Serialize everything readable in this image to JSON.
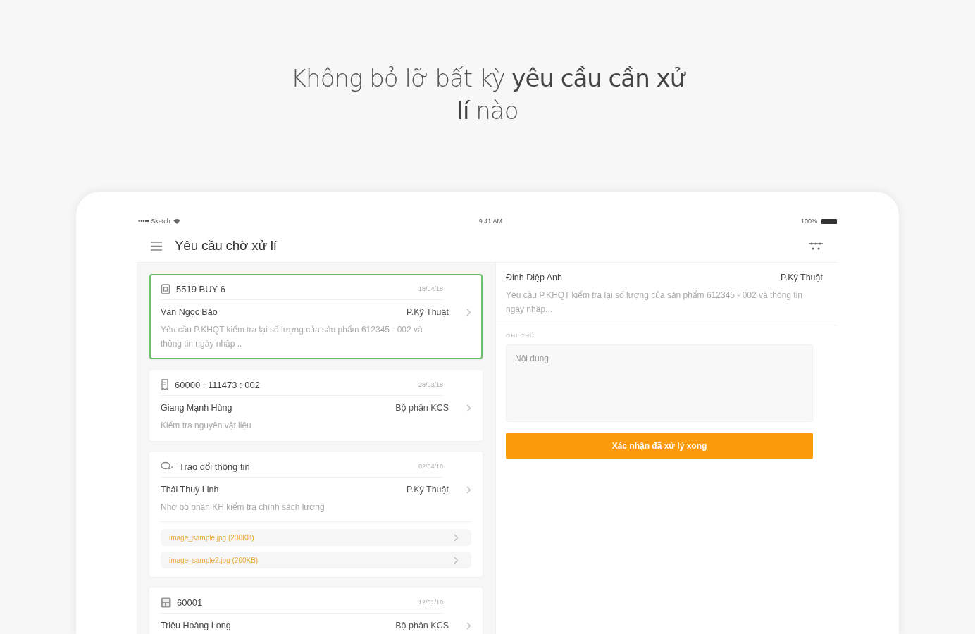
{
  "headline": "Không bỏ lỡ bất kỳ **yêu cầu cần xử lí** nào",
  "status_bar": {
    "carrier": "••••• Sketch",
    "time": "9:41 AM",
    "battery": "100%"
  },
  "header": {
    "title": "Yêu cầu chờ xử lí"
  },
  "requests": [
    {
      "kind": "document",
      "code": "5519 BUY 6",
      "date": "18/04/18",
      "name": "Văn Ngọc Bảo",
      "department": "P.Kỹ Thuật",
      "description": "Yêu cầu P.KHQT kiểm tra lại số lượng của sản phẩm 612345 - 002 và thông tin ngày nhập ..",
      "selected": true
    },
    {
      "kind": "receipt",
      "code": "60000 : 111473 : 002",
      "date": "28/03/18",
      "name": "Giang Mạnh Hùng",
      "department": "Bộ phận KCS",
      "description": "Kiểm tra nguyên vật liệu",
      "selected": false
    },
    {
      "kind": "chat",
      "code": "Trao đổi thông tin",
      "date": "02/04/18",
      "name": "Thái Thuỳ Linh",
      "department": "P.Kỹ Thuật",
      "description": "Nhờ bộ phận KH kiểm tra chính sách lương",
      "selected": false,
      "attachments": [
        "image_sample.jpg (200KB)",
        "image_sample2.jpg (200KB)"
      ]
    },
    {
      "kind": "calculator",
      "code": "60001",
      "date": "12/01/18",
      "name": "Triệu Hoàng Long",
      "department": "Bộ phận KCS",
      "selected": false
    }
  ],
  "detail": {
    "name": "Đinh Diệp Anh",
    "department": "P.Kỹ Thuật",
    "description": "Yêu cầu P.KHQT kiểm tra lại số lượng của sản phẩm 612345 - 002 và thông tin ngày nhập...",
    "note_label": "GHI CHÚ",
    "note_placeholder": "Nội dung",
    "confirm_button": "Xác nhận đã xử lý xong"
  }
}
